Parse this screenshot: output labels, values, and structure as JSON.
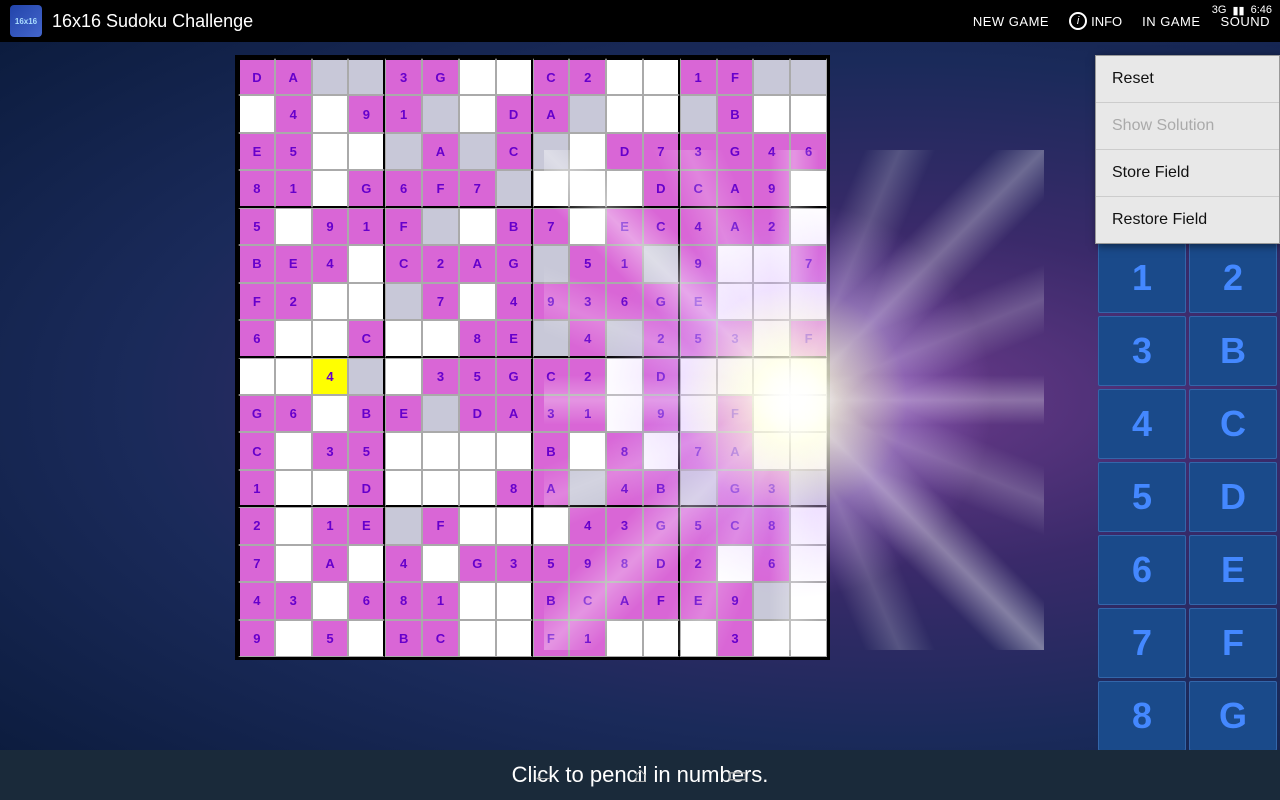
{
  "app": {
    "icon_label": "16x16",
    "title": "16x16 Sudoku Challenge"
  },
  "topbar": {
    "new_game": "NEW GAME",
    "info": "INFO",
    "in_game": "IN GAME",
    "sound": "SOUND"
  },
  "status_bar": {
    "signal": "3G",
    "time": "6:46"
  },
  "context_menu": {
    "items": [
      {
        "label": "Reset",
        "disabled": false
      },
      {
        "label": "Show Solution",
        "disabled": true
      },
      {
        "label": "Store Field",
        "disabled": false
      },
      {
        "label": "Restore Field",
        "disabled": false
      }
    ]
  },
  "num_selector": {
    "values": [
      "1",
      "2",
      "3",
      "B",
      "4",
      "C",
      "5",
      "D",
      "6",
      "E",
      "7",
      "F",
      "8",
      "G"
    ]
  },
  "bottom": {
    "text": "Click to pencil in numbers."
  },
  "grid": {
    "cells": [
      [
        "D",
        "A",
        "",
        "",
        "3",
        "G",
        "",
        "",
        "C",
        "2",
        "",
        "",
        "1",
        "F",
        "",
        ""
      ],
      [
        "",
        "4",
        "",
        "9",
        "1",
        "",
        "",
        "D",
        "A",
        "",
        "",
        "",
        "",
        "B",
        "",
        ""
      ],
      [
        "E",
        "5",
        "",
        "",
        "",
        "A",
        "",
        "C",
        "",
        "",
        "D",
        "7",
        "3",
        "G",
        "4",
        "6"
      ],
      [
        "8",
        "1",
        "",
        "G",
        "6",
        "F",
        "7",
        "",
        "",
        "",
        "",
        "D",
        "C",
        "A",
        "9",
        ""
      ],
      [
        "5",
        "",
        "9",
        "1",
        "F",
        "",
        "",
        "B",
        "7",
        "",
        "E",
        "C",
        "4",
        "A",
        "2",
        ""
      ],
      [
        "B",
        "E",
        "4",
        "",
        "C",
        "2",
        "A",
        "G",
        "",
        "5",
        "1",
        "",
        "9",
        "",
        "",
        "7"
      ],
      [
        "F",
        "2",
        "",
        "",
        "",
        "7",
        "",
        "4",
        "9",
        "3",
        "6",
        "G",
        "E",
        "",
        "",
        ""
      ],
      [
        "6",
        "",
        "",
        "C",
        "",
        "",
        "8",
        "E",
        "",
        "4",
        "",
        "2",
        "5",
        "3",
        "",
        "F"
      ],
      [
        "",
        "",
        "4",
        "",
        "",
        "3",
        "5",
        "G",
        "C",
        "2",
        "",
        "D",
        "",
        "",
        "",
        ""
      ],
      [
        "G",
        "6",
        "",
        "B",
        "E",
        "",
        "D",
        "A",
        "3",
        "1",
        "",
        "9",
        "",
        "F",
        "",
        ""
      ],
      [
        "C",
        "",
        "3",
        "5",
        "",
        "",
        "",
        "",
        "B",
        "",
        "8",
        "",
        "7",
        "A",
        "",
        ""
      ],
      [
        "1",
        "",
        "",
        "D",
        "",
        "",
        "",
        "8",
        "A",
        "",
        "4",
        "B",
        "",
        "G",
        "3",
        ""
      ],
      [
        "2",
        "",
        "1",
        "E",
        "",
        "F",
        "",
        "",
        "",
        "4",
        "3",
        "G",
        "5",
        "C",
        "8",
        ""
      ],
      [
        "7",
        "",
        "A",
        "",
        "4",
        "",
        "G",
        "3",
        "5",
        "9",
        "8",
        "D",
        "2",
        "",
        "6",
        ""
      ],
      [
        "4",
        "3",
        "",
        "6",
        "8",
        "1",
        "",
        "",
        "B",
        "C",
        "A",
        "F",
        "E",
        "9",
        "",
        ""
      ],
      [
        "9",
        "",
        "5",
        "",
        "B",
        "C",
        "",
        "",
        "F",
        "1",
        "",
        "",
        "",
        "3",
        "",
        ""
      ]
    ]
  },
  "highlighted_cell": {
    "row": 8,
    "col": 2
  },
  "nav": {
    "back": "←",
    "home": "⌂",
    "recent": "▭"
  }
}
